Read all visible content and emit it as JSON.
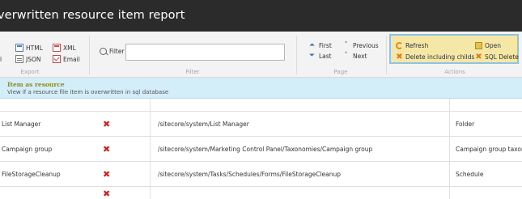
{
  "window": {
    "title": "verwritten resource item report"
  },
  "ribbon": {
    "export": {
      "label": "Export",
      "left_partial": "l",
      "html": "HTML",
      "json": "JSON",
      "xml": "XML",
      "email": "Email"
    },
    "filter": {
      "label": "Filter",
      "group_label": "Filter",
      "value": ""
    },
    "page": {
      "label": "Page",
      "first": "First",
      "last": "Last",
      "previous": "Previous",
      "next": "Next"
    },
    "actions": {
      "label": "Actions",
      "refresh": "Refresh",
      "delete_including_childs": "Delete including childs",
      "open": "Open",
      "sql_delete": "SQL Delete"
    }
  },
  "info": {
    "title": "Item as resource",
    "description": "View if a resource file item is overwritten in sql database"
  },
  "table": {
    "rows": [
      {
        "name": "List Manager",
        "overwritten": "✖",
        "path": "/sitecore/system/List Manager",
        "template": "Folder"
      },
      {
        "name": "Campaign group",
        "overwritten": "✖",
        "path": "/sitecore/system/Marketing Control Panel/Taxonomies/Campaign group",
        "template": "Campaign group taxonomy"
      },
      {
        "name": "FileStorageCleanup",
        "overwritten": "✖",
        "path": "/sitecore/system/Tasks/Schedules/Forms/FileStorageCleanup",
        "template": "Schedule"
      }
    ]
  },
  "colors": {
    "titlebar": "#2b2b2b",
    "info_bar": "#d3edf9",
    "actions_highlight": "#f5e7a6",
    "actions_border": "#8fc3e6",
    "x_mark": "#d02020"
  }
}
